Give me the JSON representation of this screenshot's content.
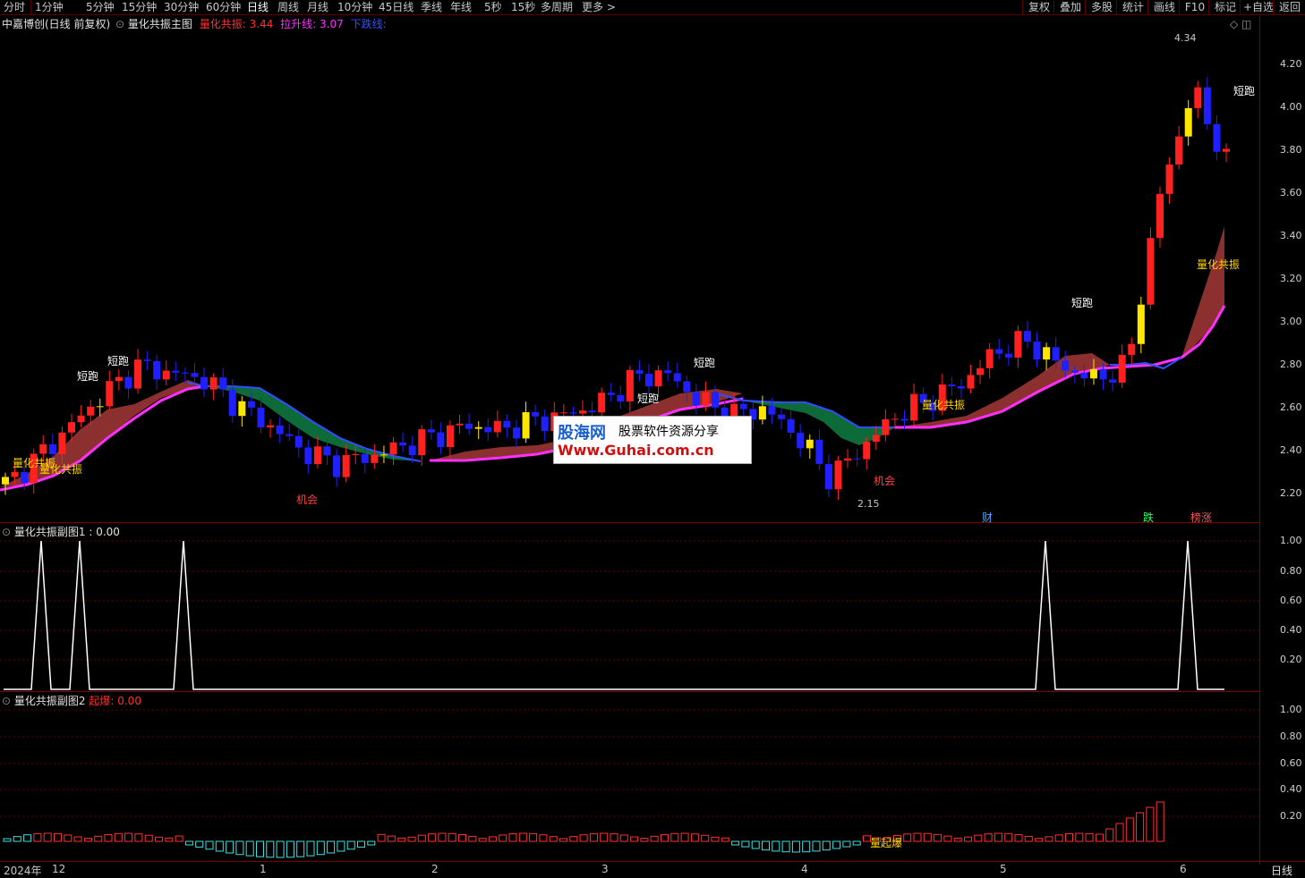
{
  "toolbar": {
    "periods": [
      "分时",
      "1分钟",
      "5分钟",
      "15分钟",
      "30分钟",
      "60分钟",
      "日线",
      "周线",
      "月线",
      "10分钟",
      "45日线",
      "季线",
      "年线",
      "5秒",
      "15秒",
      "多周期",
      "更多 >"
    ],
    "active_period": "日线",
    "right_buttons": [
      "复权",
      "叠加",
      "多股",
      "统计",
      "画线",
      "F10",
      "标记",
      "+自选",
      "返回"
    ]
  },
  "main_panel": {
    "stock_name": "中嘉博创(日线 前复权)",
    "indicator_name": "量化共振主图",
    "items": [
      {
        "label": "量化共振:",
        "value": "3.44",
        "color": "#ff3030"
      },
      {
        "label": "拉升线:",
        "value": "3.07",
        "color": "#ff30ff"
      },
      {
        "label": "下跌线:",
        "value": "",
        "color": "#3050ff"
      }
    ],
    "price_axis": [
      "4.20",
      "4.00",
      "3.80",
      "3.60",
      "3.40",
      "3.20",
      "3.00",
      "2.80",
      "2.60",
      "2.40",
      "2.20"
    ],
    "high_label": "4.34",
    "low_label": "2.15",
    "annotations": {
      "short_run": "短跑",
      "resonance": "量化共振",
      "opportunity": "机会"
    },
    "event_tags": [
      "财",
      "跌",
      "榜涨"
    ]
  },
  "sub_panel_1": {
    "title": "量化共振副图1",
    "value_text": ": 0.00",
    "axis": [
      "1.00",
      "0.80",
      "0.60",
      "0.40",
      "0.20"
    ]
  },
  "sub_panel_2": {
    "title": "量化共振副图2",
    "label": "起爆:",
    "value": "0.00",
    "axis": [
      "1.00",
      "0.80",
      "0.60",
      "0.40",
      "0.20"
    ],
    "annotation": "量起爆"
  },
  "date_axis": [
    {
      "label": "2024年"
    },
    {
      "label": "12"
    },
    {
      "label": "1"
    },
    {
      "label": "2"
    },
    {
      "label": "3"
    },
    {
      "label": "4"
    },
    {
      "label": "5"
    },
    {
      "label": "6"
    }
  ],
  "bottom_right": "日线",
  "watermark": {
    "brand": "股海网",
    "slogan": "股票软件资源分享",
    "url": "Www.Guhai.com.cn"
  },
  "chart_data": {
    "type": "candlestick",
    "ylim": [
      2.1,
      4.35
    ],
    "approx_close_path": [
      2.22,
      2.35,
      2.5,
      2.65,
      2.78,
      2.75,
      2.72,
      2.6,
      2.5,
      2.38,
      2.32,
      2.35,
      2.4,
      2.45,
      2.5,
      2.48,
      2.52,
      2.55,
      2.6,
      2.72,
      2.75,
      2.62,
      2.55,
      2.58,
      2.45,
      2.25,
      2.4,
      2.55,
      2.62,
      2.7,
      2.85,
      2.9,
      2.78,
      2.72,
      2.78,
      3.6,
      4.1,
      3.75
    ]
  }
}
